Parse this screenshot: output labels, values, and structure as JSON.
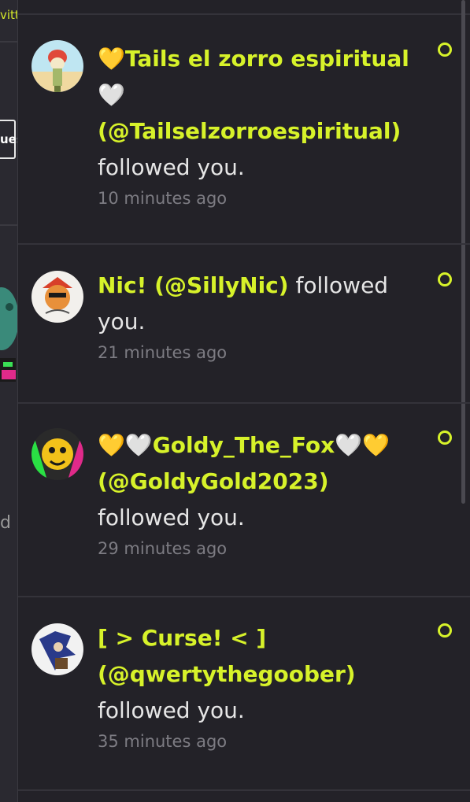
{
  "background": {
    "top_text": "vitt",
    "button_text": "ues",
    "mid_text": "d a"
  },
  "notifications": [
    {
      "heart_prefix": "💛",
      "name": "Tails el zorro espiritual",
      "heart_suffix": "🤍",
      "handle": "(@Tailselzorroespiritual)",
      "action": "followed you.",
      "time": "10 minutes ago"
    },
    {
      "heart_prefix": "",
      "name": "Nic! (@SillyNic)",
      "heart_suffix": "",
      "handle": "",
      "action": "followed you.",
      "time": "21 minutes ago"
    },
    {
      "heart_prefix": "💛🤍",
      "name": "Goldy_The_Fox",
      "heart_suffix": "🤍💛",
      "handle": "(@GoldyGold2023)",
      "action": "followed you.",
      "time": "29 minutes ago"
    },
    {
      "heart_prefix": "",
      "name": "[ > Curse! < ]",
      "heart_suffix": "",
      "handle": "(@qwertythegoober)",
      "action": "followed you.",
      "time": "35 minutes ago"
    }
  ],
  "colors": {
    "accent": "#d7f22a",
    "panel_bg": "#232228",
    "muted_text": "#7d7c83"
  }
}
